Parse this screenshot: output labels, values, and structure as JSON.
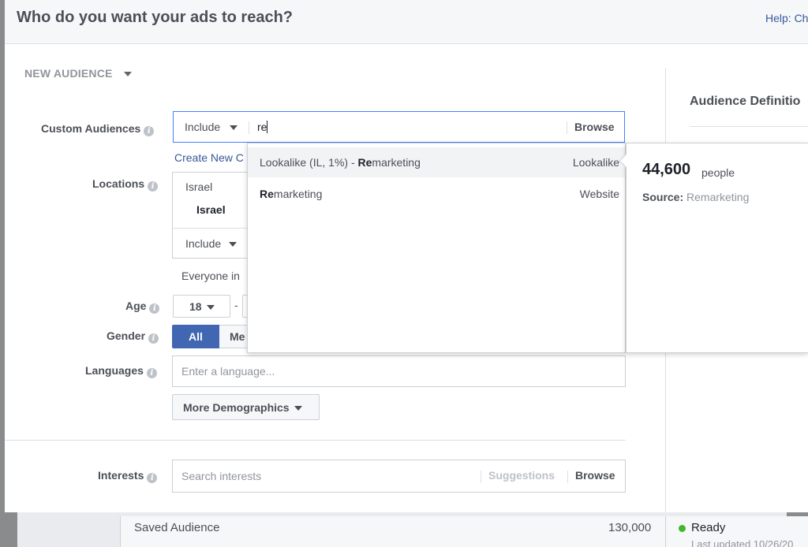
{
  "background": {
    "row_name": "Saved Audience",
    "row_size": "130,000",
    "row_status": "Ready",
    "row_updated": "Last updated 10/26/20"
  },
  "dialog": {
    "title": "Who do you want your ads to reach?",
    "help_link": "Help: Ch"
  },
  "audience_dropdown": "NEW AUDIENCE",
  "custom_audiences": {
    "label": "Custom Audiences",
    "include": "Include",
    "query": "re",
    "browse": "Browse",
    "create_new": "Create New C"
  },
  "locations": {
    "label": "Locations",
    "country": "Israel",
    "selected": "Israel",
    "include": "Include",
    "everyone": "Everyone in"
  },
  "age": {
    "label": "Age",
    "min": "18",
    "dash": "-"
  },
  "gender": {
    "label": "Gender",
    "all": "All",
    "men": "Me"
  },
  "languages": {
    "label": "Languages",
    "placeholder": "Enter a language..."
  },
  "more_demographics": "More Demographics",
  "interests": {
    "label": "Interests",
    "placeholder": "Search interests",
    "suggestions": "Suggestions",
    "browse": "Browse"
  },
  "audience_definition": "Audience Definitio",
  "dropdown": {
    "items": [
      {
        "prefix": "Lookalike (IL, 1%) - ",
        "match": "Re",
        "rest": "marketing",
        "type": "Lookalike",
        "highlighted": true
      },
      {
        "prefix": "",
        "match": "Re",
        "rest": "marketing",
        "type": "Website",
        "highlighted": false
      }
    ]
  },
  "hovercard": {
    "count": "44,600",
    "unit": "people",
    "source_label": "Source:",
    "source_value": "Remarketing"
  },
  "colors": {
    "accent": "#4267b2",
    "link": "#365899",
    "focus": "#4080ff",
    "status_ready": "#42b72a"
  }
}
